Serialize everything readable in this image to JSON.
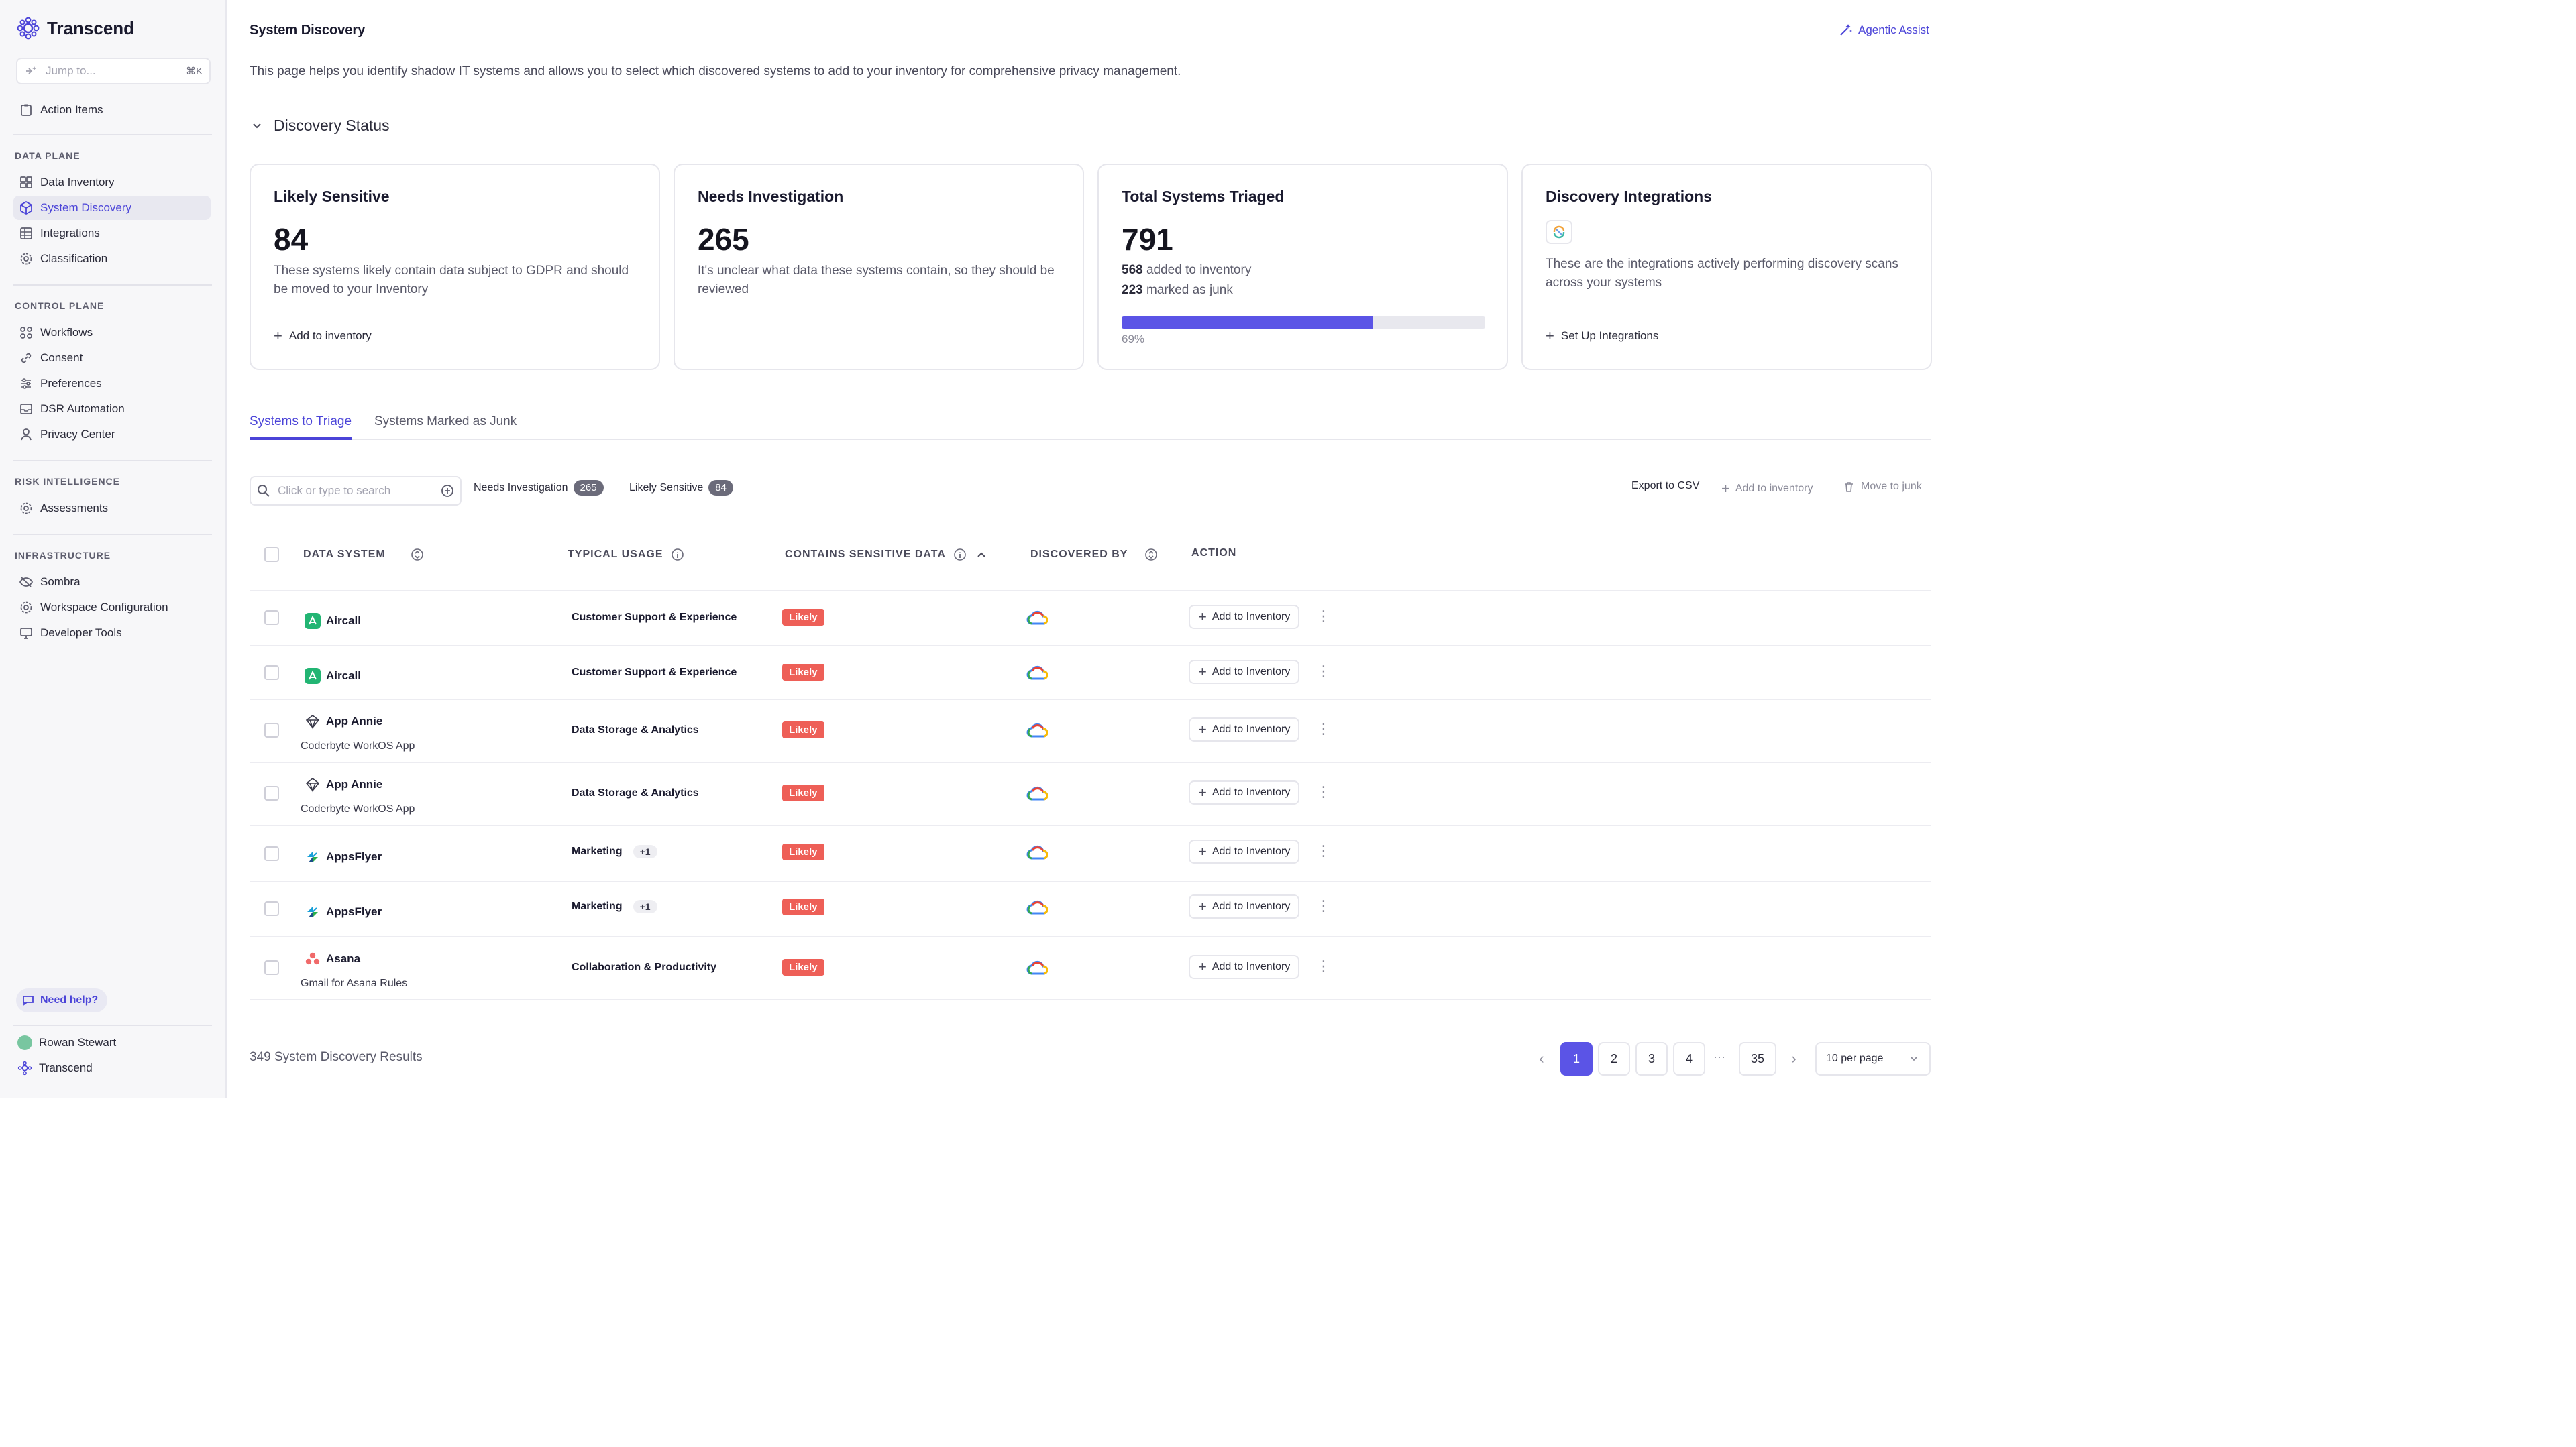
{
  "app": {
    "brand": "Transcend"
  },
  "sidebar": {
    "jump_placeholder": "Jump to...",
    "jump_shortcut": "⌘K",
    "top_items": [
      {
        "label": "Action Items",
        "icon": "clipboard-icon"
      }
    ],
    "sections": [
      {
        "title": "DATA PLANE",
        "items": [
          {
            "label": "Data Inventory",
            "icon": "grid-icon"
          },
          {
            "label": "System Discovery",
            "icon": "cube-icon",
            "active": true
          },
          {
            "label": "Integrations",
            "icon": "table-icon"
          },
          {
            "label": "Classification",
            "icon": "gear-icon"
          }
        ]
      },
      {
        "title": "CONTROL PLANE",
        "items": [
          {
            "label": "Workflows",
            "icon": "workflow-icon"
          },
          {
            "label": "Consent",
            "icon": "link-icon"
          },
          {
            "label": "Preferences",
            "icon": "sliders-icon"
          },
          {
            "label": "DSR Automation",
            "icon": "inbox-icon"
          },
          {
            "label": "Privacy Center",
            "icon": "person-icon"
          }
        ]
      },
      {
        "title": "RISK INTELLIGENCE",
        "items": [
          {
            "label": "Assessments",
            "icon": "gear-icon"
          }
        ]
      },
      {
        "title": "INFRASTRUCTURE",
        "items": [
          {
            "label": "Sombra",
            "icon": "eye-off-icon"
          },
          {
            "label": "Workspace Configuration",
            "icon": "gear-icon"
          },
          {
            "label": "Developer Tools",
            "icon": "monitor-icon"
          }
        ]
      }
    ],
    "help_label": "Need help?",
    "user_name": "Rowan Stewart",
    "org_name": "Transcend"
  },
  "header": {
    "title": "System Discovery",
    "agentic_label": "Agentic Assist",
    "description": "This page helps you identify shadow IT systems and allows you to select which discovered systems to add to your inventory for comprehensive privacy management."
  },
  "status": {
    "toggle_label": "Discovery Status",
    "cards": {
      "sensitive": {
        "title": "Likely Sensitive",
        "value": "84",
        "desc": "These systems likely contain data subject to GDPR and should be moved to your Inventory",
        "link": "Add to inventory"
      },
      "investigation": {
        "title": "Needs Investigation",
        "value": "265",
        "desc": "It's unclear what data these systems contain, so they should be reviewed"
      },
      "triaged": {
        "title": "Total Systems Triaged",
        "value": "791",
        "added_count": "568",
        "added_label": "added to inventory",
        "junk_count": "223",
        "junk_label": "marked as junk",
        "progress": 0.69,
        "progress_label": "69%"
      },
      "integrations": {
        "title": "Discovery Integrations",
        "desc": "These are the integrations actively performing discovery scans across your systems",
        "link": "Set Up Integrations"
      }
    }
  },
  "tabs": [
    {
      "label": "Systems to Triage",
      "active": true
    },
    {
      "label": "Systems Marked as Junk",
      "active": false
    }
  ],
  "toolbar": {
    "search_placeholder": "Click or type to search",
    "filters": [
      {
        "label": "Needs Investigation",
        "count": "265"
      },
      {
        "label": "Likely Sensitive",
        "count": "84"
      }
    ],
    "export_label": "Export to CSV",
    "add_label": "Add to inventory",
    "junk_label": "Move to junk"
  },
  "table": {
    "headers": {
      "system": "DATA SYSTEM",
      "usage": "TYPICAL USAGE",
      "sensitive": "CONTAINS SENSITIVE DATA",
      "discovered": "DISCOVERED BY",
      "action": "ACTION"
    },
    "rows": [
      {
        "name": "Aircall",
        "sub": "",
        "usage": "Customer Support & Experience",
        "more": "",
        "sensitive": "Likely",
        "action": "Add to Inventory"
      },
      {
        "name": "Aircall",
        "sub": "",
        "usage": "Customer Support & Experience",
        "more": "",
        "sensitive": "Likely",
        "action": "Add to Inventory"
      },
      {
        "name": "App Annie",
        "sub": "Coderbyte WorkOS App",
        "usage": "Data Storage & Analytics",
        "more": "",
        "sensitive": "Likely",
        "action": "Add to Inventory"
      },
      {
        "name": "App Annie",
        "sub": "Coderbyte WorkOS App",
        "usage": "Data Storage & Analytics",
        "more": "",
        "sensitive": "Likely",
        "action": "Add to Inventory"
      },
      {
        "name": "AppsFlyer",
        "sub": "",
        "usage": "Marketing",
        "more": "+1",
        "sensitive": "Likely",
        "action": "Add to Inventory"
      },
      {
        "name": "AppsFlyer",
        "sub": "",
        "usage": "Marketing",
        "more": "+1",
        "sensitive": "Likely",
        "action": "Add to Inventory"
      },
      {
        "name": "Asana",
        "sub": "Gmail for Asana Rules",
        "usage": "Collaboration & Productivity",
        "more": "",
        "sensitive": "Likely",
        "action": "Add to Inventory"
      }
    ]
  },
  "footer": {
    "results": "349 System Discovery Results",
    "pages": [
      "1",
      "2",
      "3",
      "4",
      "35"
    ],
    "ellipsis": "···",
    "per_page": "10 per page"
  },
  "colors": {
    "accent": "#5b54e6",
    "likely": "#ee5f57"
  }
}
